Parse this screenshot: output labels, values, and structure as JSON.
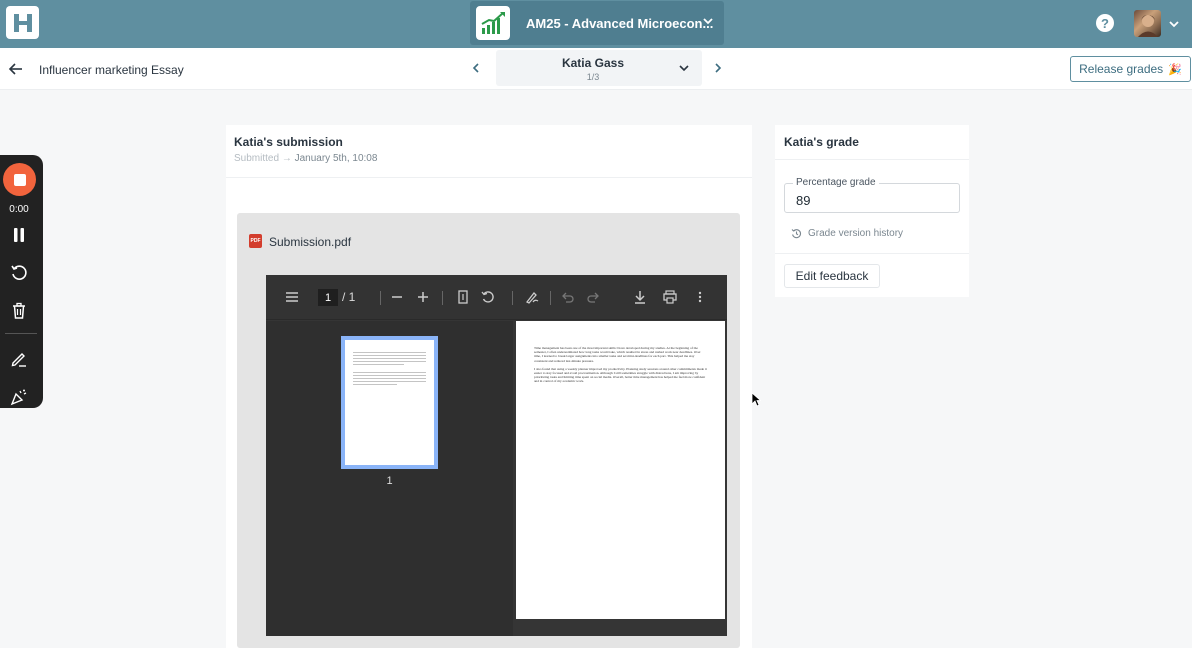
{
  "topbar": {
    "course_title": "AM25 - Advanced Microecon...",
    "help_label": "?"
  },
  "header": {
    "assignment_name": "Influencer marketing Essay",
    "student_name": "Katia Gass",
    "student_position": "1/3",
    "release_label": "Release grades",
    "release_emoji": "🎉"
  },
  "recorder": {
    "time": "0:00"
  },
  "submission": {
    "title": "Katia's submission",
    "status": "Submitted",
    "date": "January 5th, 10:08",
    "file_name": "Submission.pdf",
    "pdf_badge": "PDF",
    "viewer": {
      "page_current": "1",
      "page_total": "/  1",
      "thumb_label": "1",
      "paragraph_1": "Time management has been one of the most important skills I have developed during my studies. At the beginning of the semester, I often underestimated how long tasks would take, which resulted in stress and rushed work near deadlines. Over time, I learned to break larger assignments into smaller tasks and set mini-deadlines for each part. This helped me stay consistent and reduced last-minute pressure.",
      "paragraph_2": "I also found that using a weekly planner improved my productivity. Planning study sessions around other commitments made it easier to stay focused and avoid procrastination. Although I still sometimes struggle with distractions, I am improving by prioritizing tasks and limiting time spent on social media. Overall, better time management has helped me feel more confident and in control of my academic work."
    }
  },
  "grade": {
    "title": "Katia's grade",
    "field_label": "Percentage grade",
    "value": "89",
    "history_label": "Grade version history",
    "edit_feedback_label": "Edit feedback"
  },
  "colors": {
    "topbar": "#5f8fa0",
    "accent": "#3d6d80",
    "record": "#f2643d"
  }
}
